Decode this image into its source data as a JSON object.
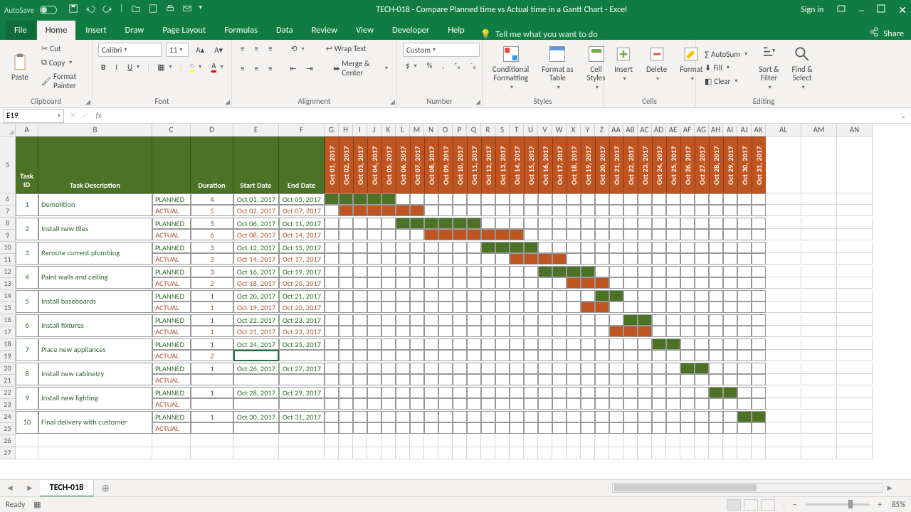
{
  "titlebar": {
    "autosave": "AutoSave",
    "title": "TECH-018 - Compare Planned time vs Actual time in a Gantt Chart  -  Excel",
    "signin": "Sign in"
  },
  "tabs": {
    "file": "File",
    "home": "Home",
    "insert": "Insert",
    "draw": "Draw",
    "pagelayout": "Page Layout",
    "formulas": "Formulas",
    "data": "Data",
    "review": "Review",
    "view": "View",
    "developer": "Developer",
    "help": "Help",
    "tell": "Tell me what you want to do",
    "share": "Share"
  },
  "ribbon": {
    "paste": "Paste",
    "cut": "Cut",
    "copy": "Copy",
    "painter": "Format Painter",
    "clipboard": "Clipboard",
    "font_name": "Calibri",
    "font_size": "11",
    "font": "Font",
    "wrap": "Wrap Text",
    "merge": "Merge & Center",
    "alignment": "Alignment",
    "numfmt": "Custom",
    "number": "Number",
    "condfmt": "Conditional\nFormatting",
    "fmttable": "Format as\nTable",
    "cellstyles": "Cell\nStyles",
    "styles": "Styles",
    "insert_btn": "Insert",
    "delete_btn": "Delete",
    "format_btn": "Format",
    "cells": "Cells",
    "autosum": "AutoSum",
    "fill": "Fill",
    "clear": "Clear",
    "sortfilter": "Sort &\nFilter",
    "findselect": "Find &\nSelect",
    "editing": "Editing"
  },
  "fbar": {
    "ref": "E19"
  },
  "headers": {
    "taskid": "Task\nID",
    "desc": "Task Description",
    "c_blank": "",
    "duration": "Duration",
    "start": "Start Date",
    "end": "End Date",
    "dates": [
      "Oct 01, 2017",
      "Oct 02, 2017",
      "Oct 03, 2017",
      "Oct 04, 2017",
      "Oct 05, 2017",
      "Oct 06, 2017",
      "Oct 07, 2017",
      "Oct 08, 2017",
      "Oct 09, 2017",
      "Oct 10, 2017",
      "Oct 11, 2017",
      "Oct 12, 2017",
      "Oct 13, 2017",
      "Oct 14, 2017",
      "Oct 15, 2017",
      "Oct 16, 2017",
      "Oct 17, 2017",
      "Oct 18, 2017",
      "Oct 19, 2017",
      "Oct 20, 2017",
      "Oct 21, 2017",
      "Oct 22, 2017",
      "Oct 23, 2017",
      "Oct 24, 2017",
      "Oct 25, 2017",
      "Oct 26, 2017",
      "Oct 27, 2017",
      "Oct 28, 2017",
      "Oct 29, 2017",
      "Oct 30, 2017",
      "Oct 31, 2017"
    ]
  },
  "tasks": [
    {
      "id": "1",
      "desc": "Demolition",
      "planned": {
        "dur": "4",
        "start": "Oct 01, 2017",
        "end": "Oct 05, 2017",
        "bar": [
          1,
          5
        ]
      },
      "actual": {
        "dur": "5",
        "start": "Oct 02, 2017",
        "end": "Oct 07, 2017",
        "bar": [
          2,
          7
        ]
      }
    },
    {
      "id": "2",
      "desc": "Install new tiles",
      "planned": {
        "dur": "5",
        "start": "Oct 06, 2017",
        "end": "Oct 11, 2017",
        "bar": [
          6,
          11
        ]
      },
      "actual": {
        "dur": "6",
        "start": "Oct 08, 2017",
        "end": "Oct 14, 2017",
        "bar": [
          8,
          14
        ]
      }
    },
    {
      "id": "3",
      "desc": "Reroute current plumbing",
      "planned": {
        "dur": "3",
        "start": "Oct 12, 2017",
        "end": "Oct 15, 2017",
        "bar": [
          12,
          15
        ]
      },
      "actual": {
        "dur": "3",
        "start": "Oct 14, 2017",
        "end": "Oct 17, 2017",
        "bar": [
          14,
          17
        ]
      }
    },
    {
      "id": "4",
      "desc": "Paint walls and ceiling",
      "planned": {
        "dur": "3",
        "start": "Oct 16, 2017",
        "end": "Oct 19, 2017",
        "bar": [
          16,
          19
        ]
      },
      "actual": {
        "dur": "2",
        "start": "Oct 18, 2017",
        "end": "Oct 20, 2017",
        "bar": [
          18,
          20
        ]
      }
    },
    {
      "id": "5",
      "desc": "Install baseboards",
      "planned": {
        "dur": "1",
        "start": "Oct 20, 2017",
        "end": "Oct 21, 2017",
        "bar": [
          20,
          21
        ]
      },
      "actual": {
        "dur": "1",
        "start": "Oct 19, 2017",
        "end": "Oct 20, 2017",
        "bar": [
          19,
          20
        ]
      }
    },
    {
      "id": "6",
      "desc": "Install fixtures",
      "planned": {
        "dur": "1",
        "start": "Oct 22, 2017",
        "end": "Oct 23, 2017",
        "bar": [
          22,
          23
        ]
      },
      "actual": {
        "dur": "1",
        "start": "Oct 21, 2017",
        "end": "Oct 23, 2017",
        "bar": [
          21,
          23
        ]
      }
    },
    {
      "id": "7",
      "desc": "Place new appliances",
      "planned": {
        "dur": "1",
        "start": "Oct 24, 2017",
        "end": "Oct 25, 2017",
        "bar": [
          24,
          25
        ]
      },
      "actual": {
        "dur": "2",
        "start": "",
        "end": "",
        "bar": null
      }
    },
    {
      "id": "8",
      "desc": "Install new cabinetry",
      "planned": {
        "dur": "1",
        "start": "Oct 26, 2017",
        "end": "Oct 27, 2017",
        "bar": [
          26,
          27
        ]
      },
      "actual": {
        "dur": "",
        "start": "",
        "end": "",
        "bar": null
      }
    },
    {
      "id": "9",
      "desc": "Install new lighting",
      "planned": {
        "dur": "1",
        "start": "Oct 28, 2017",
        "end": "Oct 29, 2017",
        "bar": [
          28,
          29
        ]
      },
      "actual": {
        "dur": "",
        "start": "",
        "end": "",
        "bar": null
      }
    },
    {
      "id": "10",
      "desc": "Final delivery with customer",
      "planned": {
        "dur": "1",
        "start": "Oct 30, 2017",
        "end": "Oct 31, 2017",
        "bar": [
          30,
          31
        ]
      },
      "actual": {
        "dur": "",
        "start": "",
        "end": "",
        "bar": null
      }
    }
  ],
  "labels": {
    "planned": "PLANNED",
    "actual": "ACTUAL"
  },
  "sheet": {
    "name": "TECH-018"
  },
  "status": {
    "ready": "Ready",
    "zoom": "85%"
  },
  "cols": {
    "letters": [
      "A",
      "B",
      "C",
      "D",
      "E",
      "F",
      "G",
      "H",
      "I",
      "J",
      "K",
      "L",
      "M",
      "N",
      "O",
      "P",
      "Q",
      "R",
      "S",
      "T",
      "U",
      "V",
      "W",
      "X",
      "Y",
      "Z",
      "AA",
      "AB",
      "AC",
      "AD",
      "AE",
      "AF",
      "AG",
      "AH",
      "AI",
      "AJ",
      "AK",
      "AL",
      "AM",
      "AN"
    ],
    "widths": [
      32,
      160,
      54,
      60,
      64,
      64,
      20,
      20,
      20,
      20,
      20,
      20,
      20,
      20,
      20,
      20,
      20,
      20,
      20,
      20,
      20,
      20,
      20,
      20,
      20,
      20,
      20,
      20,
      20,
      20,
      20,
      20,
      20,
      20,
      20,
      20,
      20,
      50,
      50,
      50
    ]
  },
  "chart_data": {
    "type": "gantt",
    "title": "Compare Planned time vs Actual time in a Gantt Chart",
    "x_unit": "day",
    "x_range": [
      "2017-10-01",
      "2017-10-31"
    ],
    "series": [
      "PLANNED",
      "ACTUAL"
    ],
    "colors": {
      "PLANNED": "#4c7225",
      "ACTUAL": "#c05522"
    },
    "tasks": [
      {
        "id": 1,
        "name": "Demolition",
        "PLANNED": {
          "start": "2017-10-01",
          "end": "2017-10-05",
          "duration": 4
        },
        "ACTUAL": {
          "start": "2017-10-02",
          "end": "2017-10-07",
          "duration": 5
        }
      },
      {
        "id": 2,
        "name": "Install new tiles",
        "PLANNED": {
          "start": "2017-10-06",
          "end": "2017-10-11",
          "duration": 5
        },
        "ACTUAL": {
          "start": "2017-10-08",
          "end": "2017-10-14",
          "duration": 6
        }
      },
      {
        "id": 3,
        "name": "Reroute current plumbing",
        "PLANNED": {
          "start": "2017-10-12",
          "end": "2017-10-15",
          "duration": 3
        },
        "ACTUAL": {
          "start": "2017-10-14",
          "end": "2017-10-17",
          "duration": 3
        }
      },
      {
        "id": 4,
        "name": "Paint walls and ceiling",
        "PLANNED": {
          "start": "2017-10-16",
          "end": "2017-10-19",
          "duration": 3
        },
        "ACTUAL": {
          "start": "2017-10-18",
          "end": "2017-10-20",
          "duration": 2
        }
      },
      {
        "id": 5,
        "name": "Install baseboards",
        "PLANNED": {
          "start": "2017-10-20",
          "end": "2017-10-21",
          "duration": 1
        },
        "ACTUAL": {
          "start": "2017-10-19",
          "end": "2017-10-20",
          "duration": 1
        }
      },
      {
        "id": 6,
        "name": "Install fixtures",
        "PLANNED": {
          "start": "2017-10-22",
          "end": "2017-10-23",
          "duration": 1
        },
        "ACTUAL": {
          "start": "2017-10-21",
          "end": "2017-10-23",
          "duration": 1
        }
      },
      {
        "id": 7,
        "name": "Place new appliances",
        "PLANNED": {
          "start": "2017-10-24",
          "end": "2017-10-25",
          "duration": 1
        },
        "ACTUAL": {
          "duration": 2
        }
      },
      {
        "id": 8,
        "name": "Install new cabinetry",
        "PLANNED": {
          "start": "2017-10-26",
          "end": "2017-10-27",
          "duration": 1
        },
        "ACTUAL": {}
      },
      {
        "id": 9,
        "name": "Install new lighting",
        "PLANNED": {
          "start": "2017-10-28",
          "end": "2017-10-29",
          "duration": 1
        },
        "ACTUAL": {}
      },
      {
        "id": 10,
        "name": "Final delivery with customer",
        "PLANNED": {
          "start": "2017-10-30",
          "end": "2017-10-31",
          "duration": 1
        },
        "ACTUAL": {}
      }
    ]
  }
}
